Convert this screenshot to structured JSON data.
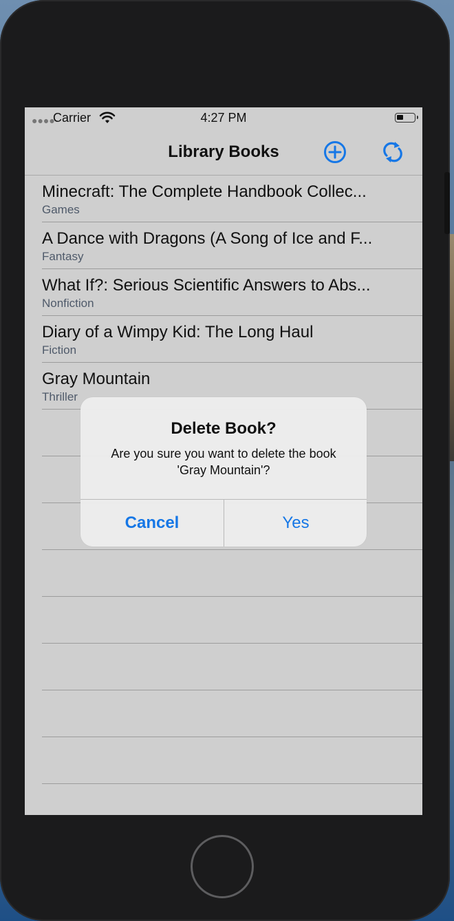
{
  "status_bar": {
    "carrier": "Carrier",
    "time": "4:27 PM",
    "wifi_icon": "wifi-icon",
    "battery_icon": "battery-icon"
  },
  "nav": {
    "title": "Library Books",
    "add_icon": "plus-circle-icon",
    "refresh_icon": "refresh-icon",
    "accent_color": "#1677e6"
  },
  "books": [
    {
      "title": "Minecraft: The Complete Handbook Collec...",
      "genre": "Games"
    },
    {
      "title": "A Dance with Dragons (A Song of Ice and F...",
      "genre": "Fantasy"
    },
    {
      "title": "What If?: Serious Scientific Answers to Abs...",
      "genre": "Nonfiction"
    },
    {
      "title": "Diary of a Wimpy Kid: The Long Haul",
      "genre": "Fiction"
    },
    {
      "title": "Gray Mountain",
      "genre": "Thriller"
    }
  ],
  "alert": {
    "title": "Delete Book?",
    "message": "Are you sure you want to delete the book 'Gray Mountain'?",
    "cancel_label": "Cancel",
    "confirm_label": "Yes"
  }
}
